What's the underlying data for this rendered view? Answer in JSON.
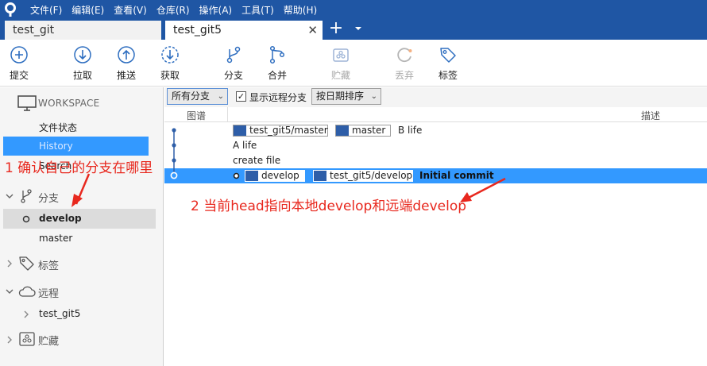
{
  "menu": {
    "items": [
      "文件(F)",
      "编辑(E)",
      "查看(V)",
      "仓库(R)",
      "操作(A)",
      "工具(T)",
      "帮助(H)"
    ]
  },
  "tabs": [
    {
      "label": "test_git",
      "active": false
    },
    {
      "label": "test_git5",
      "active": true
    }
  ],
  "toolbar": {
    "commit": "提交",
    "pull": "拉取",
    "push": "推送",
    "fetch": "获取",
    "branch": "分支",
    "merge": "合并",
    "stash": "贮藏",
    "discard": "丢弃",
    "tag": "标签"
  },
  "sidebar": {
    "workspace": "WORKSPACE",
    "file_status": "文件状态",
    "history": "History",
    "search": "Search",
    "branches": "分支",
    "branch_items": [
      "develop",
      "master"
    ],
    "tags": "标签",
    "remotes": "远程",
    "remote_items": [
      "test_git5"
    ],
    "stashes": "贮藏"
  },
  "filter": {
    "branch_select": "所有分支",
    "show_remote": "显示远程分支",
    "show_remote_checked": true,
    "sort_select": "按日期排序"
  },
  "columns": {
    "graph": "图谱",
    "description": "描述"
  },
  "commits": [
    {
      "refs": [
        "test_git5/master",
        "master"
      ],
      "message": "B life",
      "selected": false
    },
    {
      "refs": [],
      "message": "A life",
      "selected": false
    },
    {
      "refs": [],
      "message": "create file",
      "selected": false
    },
    {
      "refs": [
        "develop",
        "test_git5/develop"
      ],
      "message": "Initial commit",
      "selected": true
    }
  ],
  "annotations": {
    "note1": "1 确认自己的分支在哪里",
    "note2": "2 当前head指向本地develop和远端develop"
  },
  "colors": {
    "menubar": "#1f56a4",
    "selection": "#3399ff",
    "ref_icon": "#2e5ea8",
    "annotation": "#e8281e"
  }
}
